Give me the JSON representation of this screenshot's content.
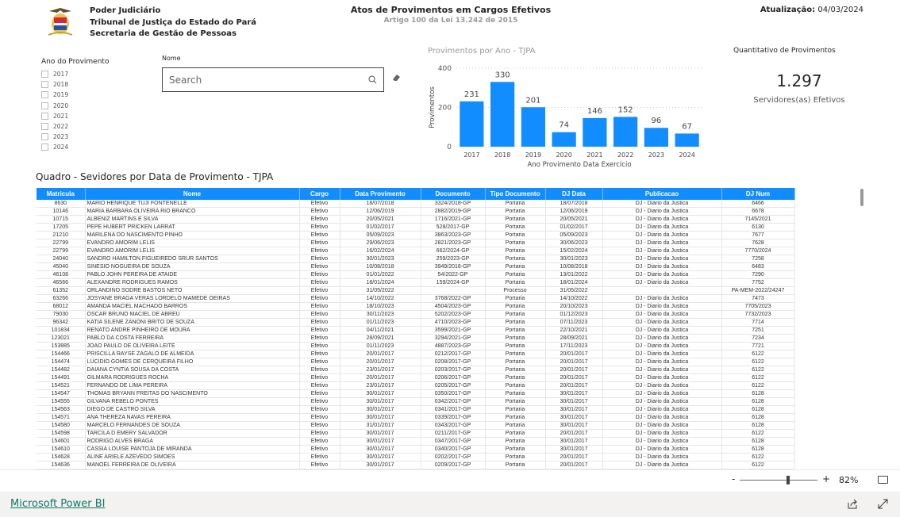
{
  "header": {
    "org_lines": [
      "Poder Judiciário",
      "Tribunal de Justiça do Estado do Pará",
      "Secretaria de Gestão de Pessoas"
    ],
    "title": "Atos de Provimentos em Cargos Efetivos",
    "subtitle": "Artigo 100 da Lei 13.242 de 2015",
    "update_label": "Atualização:",
    "update_value": "04/03/2024"
  },
  "slicer": {
    "title": "Ano do Provimento",
    "years": [
      "2017",
      "2018",
      "2019",
      "2020",
      "2021",
      "2022",
      "2023",
      "2024"
    ]
  },
  "search": {
    "label": "Nome",
    "placeholder": "Search"
  },
  "chart_data": {
    "type": "bar",
    "title": "Provimentos por Ano - TJPA",
    "xlabel": "Ano Provimento Data Exercício",
    "ylabel": "Provimentos",
    "categories": [
      "2017",
      "2018",
      "2019",
      "2020",
      "2021",
      "2022",
      "2023",
      "2024"
    ],
    "values": [
      231,
      330,
      201,
      74,
      146,
      152,
      96,
      67
    ],
    "ylim": [
      0,
      400
    ],
    "yticks": [
      0,
      200,
      400
    ],
    "grid": true,
    "color": "#118DFF"
  },
  "kpi": {
    "title": "Quantitativo de Provimentos",
    "value": "1.297",
    "label": "Servidores(as) Efetivos"
  },
  "table": {
    "title": "Quadro - Sevidores por Data de Provimento - TJPA",
    "columns": [
      "Matricula",
      "Nome",
      "Cargo",
      "Data Provimento",
      "Documento",
      "Tipo Documento",
      "DJ Data",
      "Publicacao",
      "DJ Num"
    ],
    "rows": [
      [
        "8630",
        "MARIO HENRIQUE TUJI FONTENELLE",
        "Efetivo",
        "18/07/2018",
        "3324/2018-GP",
        "Portaria",
        "18/07/2018",
        "DJ - Diario da Justica",
        "6466"
      ],
      [
        "10146",
        "MARIA BARBARA OLIVEIRA RIO BRANCO",
        "Efetivo",
        "12/06/2019",
        "2882/2019-GP",
        "Portaria",
        "12/06/2019",
        "DJ - Diario da Justica",
        "6678"
      ],
      [
        "10715",
        "ALBENIZ MARTINS E SILVA",
        "Efetivo",
        "20/05/2021",
        "1716/2021-GP",
        "Portaria",
        "20/05/2021",
        "DJ - Diario da Justica",
        "7145/2021"
      ],
      [
        "17205",
        "PEPE HUBERT PRICKEN LARRAT",
        "Efetivo",
        "01/02/2017",
        "528/2017-GP",
        "Portaria",
        "01/02/2017",
        "DJ - Diario da Justica",
        "6130"
      ],
      [
        "21210",
        "MARILENA DO NASCIMENTO PINHO",
        "Efetivo",
        "05/09/2023",
        "3863/2023-GP",
        "Portaria",
        "05/09/2023",
        "DJ - Diario da Justica",
        "7677"
      ],
      [
        "22799",
        "EVANDRO AMORIM LELIS",
        "Efetivo",
        "29/06/2023",
        "2821/2023-GP",
        "Portaria",
        "30/06/2023",
        "DJ - Diario da Justica",
        "7628"
      ],
      [
        "22799",
        "EVANDRO AMORIM LELIS",
        "Efetivo",
        "16/02/2024",
        "662/2024-GP",
        "Portaria",
        "15/02/2024",
        "DJ - Diario da Justica",
        "7770/2024"
      ],
      [
        "24040",
        "SANDRO HAMILTON FIGUEIREDO SRUR SANTOS",
        "Efetivo",
        "30/01/2023",
        "259/2023-GP",
        "Portaria",
        "30/01/2023",
        "DJ - Diario da Justica",
        "7258"
      ],
      [
        "45040",
        "SINESIO NOGUEIRA DE SOUZA",
        "Efetivo",
        "10/08/2018",
        "3949/2018-GP",
        "Portaria",
        "10/08/2018",
        "DJ - Diario da Justica",
        "6483"
      ],
      [
        "46108",
        "PABLO JOHN PEREIRA DE ATAIDE",
        "Efetivo",
        "01/01/2022",
        "54/2022-GP",
        "Portaria",
        "13/01/2022",
        "DJ - Diario da Justica",
        "7290"
      ],
      [
        "46566",
        "ALEXANDRE RODRIGUES RAMOS",
        "Efetivo",
        "18/01/2024",
        "159/2024-GP",
        "Portaria",
        "18/01/2024",
        "DJ - Diario da Justica",
        "7752"
      ],
      [
        "61352",
        "ORLANDINO SODRE BASTOS NETO",
        "Efetivo",
        "31/05/2022",
        "",
        "Processo",
        "31/05/2022",
        "",
        "PA-MEM-2022/24247"
      ],
      [
        "63266",
        "JOSYANE BRAGA VERAS LORDELO MAMEDE OEIRAS",
        "Efetivo",
        "14/10/2022",
        "3768/2022-GP",
        "Portaria",
        "14/10/2022",
        "DJ - Diario da Justica",
        "7473"
      ],
      [
        "68012",
        "AMANDA MACIEL MACHADO BARROS",
        "Efetivo",
        "18/10/2023",
        "4504/2023-GP",
        "Portaria",
        "20/10/2023",
        "DJ - Diario da Justica",
        "7705/2023"
      ],
      [
        "79030",
        "OSCAR BRUNO MACIEL DE ABREU",
        "Efetivo",
        "30/11/2023",
        "5202/2023-GP",
        "Portaria",
        "01/12/2023",
        "DJ - Diario da Justica",
        "7732/2023"
      ],
      [
        "96342",
        "KATIA SILENE ZANONI BRITO DE SOUZA",
        "Efetivo",
        "01/11/2023",
        "4710/2023-GP",
        "Portaria",
        "07/11/2023",
        "DJ - Diario da Justica",
        "7714"
      ],
      [
        "101834",
        "RENATO ANDRE PINHEIRO DE MOURA",
        "Efetivo",
        "04/11/2021",
        "3599/2021-GP",
        "Portaria",
        "22/10/2021",
        "DJ - Diario da Justica",
        "7251"
      ],
      [
        "123021",
        "PABLO DA COSTA FERREIRA",
        "Efetivo",
        "28/09/2021",
        "3294/2021-GP",
        "Portaria",
        "28/09/2021",
        "DJ - Diario da Justica",
        "7234"
      ],
      [
        "153885",
        "JOAO PAULO DE OLIVEIRA LEITE",
        "Efetivo",
        "01/11/2023",
        "4887/2023-GP",
        "Portaria",
        "17/11/2023",
        "DJ - Diario da Justica",
        "7721"
      ],
      [
        "154466",
        "PRISCILLA RAYSE ZAGALO DE ALMEIDA",
        "Efetivo",
        "20/01/2017",
        "0212/2017-GP",
        "Portaria",
        "20/01/2017",
        "DJ - Diario da Justica",
        "6122"
      ],
      [
        "154474",
        "LUCIDIO GOMES DE CERQUEIRA FILHO",
        "Efetivo",
        "20/01/2017",
        "0208/2017-GP",
        "Portaria",
        "20/01/2017",
        "DJ - Diario da Justica",
        "6122"
      ],
      [
        "154482",
        "DAIANA CYNTIA SOUSA DA COSTA",
        "Efetivo",
        "23/01/2017",
        "0203/2017-GP",
        "Portaria",
        "20/01/2017",
        "DJ - Diario da Justica",
        "6122"
      ],
      [
        "154491",
        "GILMARA RODRIGUES ROCHA",
        "Efetivo",
        "20/01/2017",
        "0206/2017-GP",
        "Portaria",
        "20/01/2017",
        "DJ - Diario da Justica",
        "6122"
      ],
      [
        "154521",
        "FERNANDO DE LIMA PEREIRA",
        "Efetivo",
        "23/01/2017",
        "0205/2017-GP",
        "Portaria",
        "20/01/2017",
        "DJ - Diario da Justica",
        "6122"
      ],
      [
        "154547",
        "THOMAS BRYANN FREITAS DO NASCIMENTO",
        "Efetivo",
        "30/01/2017",
        "0350/2017-GP",
        "Portaria",
        "30/01/2017",
        "DJ - Diario da Justica",
        "6128"
      ],
      [
        "154555",
        "GILVANA REBELO PONTES",
        "Efetivo",
        "30/01/2017",
        "0342/2017-GP",
        "Portaria",
        "30/01/2017",
        "DJ - Diario da Justica",
        "6128"
      ],
      [
        "154563",
        "DIEGO DE CASTRO SILVA",
        "Efetivo",
        "30/01/2017",
        "0341/2017-GP",
        "Portaria",
        "30/01/2017",
        "DJ - Diario da Justica",
        "6128"
      ],
      [
        "154571",
        "ANA THEREZA NAVAS PEREIRA",
        "Efetivo",
        "30/01/2017",
        "0339/2017-GP",
        "Portaria",
        "30/01/2017",
        "DJ - Diario da Justica",
        "6128"
      ],
      [
        "154580",
        "MARCELO FERNANDES DE SOUZA",
        "Efetivo",
        "31/01/2017",
        "0343/2017-GP",
        "Portaria",
        "30/01/2017",
        "DJ - Diario da Justica",
        "6128"
      ],
      [
        "154598",
        "TARCILA D EMERY SALVADOR",
        "Efetivo",
        "30/01/2017",
        "0211/2017-GP",
        "Portaria",
        "20/01/2017",
        "DJ - Diario da Justica",
        "6122"
      ],
      [
        "154601",
        "RODRIGO ALVES BRAGA",
        "Efetivo",
        "30/01/2017",
        "0347/2017-GP",
        "Portaria",
        "30/01/2017",
        "DJ - Diario da Justica",
        "6128"
      ],
      [
        "154610",
        "CASSIA LOUISE PANTOJA DE MIRANDA",
        "Efetivo",
        "30/01/2017",
        "0340/2017-GP",
        "Portaria",
        "30/01/2017",
        "DJ - Diario da Justica",
        "6128"
      ],
      [
        "154628",
        "ALINE ARIELE AZEVEDO SIMOES",
        "Efetivo",
        "30/01/2017",
        "0202/2017-GP",
        "Portaria",
        "20/01/2017",
        "DJ - Diario da Justica",
        "6122"
      ],
      [
        "154636",
        "MANOEL FERREIRA DE OLIVEIRA",
        "Efetivo",
        "30/01/2017",
        "0209/2017-GP",
        "Portaria",
        "20/01/2017",
        "DJ - Diario da Justica",
        "6122"
      ]
    ]
  },
  "zoom": {
    "minus": "-",
    "plus": "+",
    "value": "82%",
    "level_percent": 82
  },
  "footer": {
    "link": "Microsoft Power BI"
  }
}
